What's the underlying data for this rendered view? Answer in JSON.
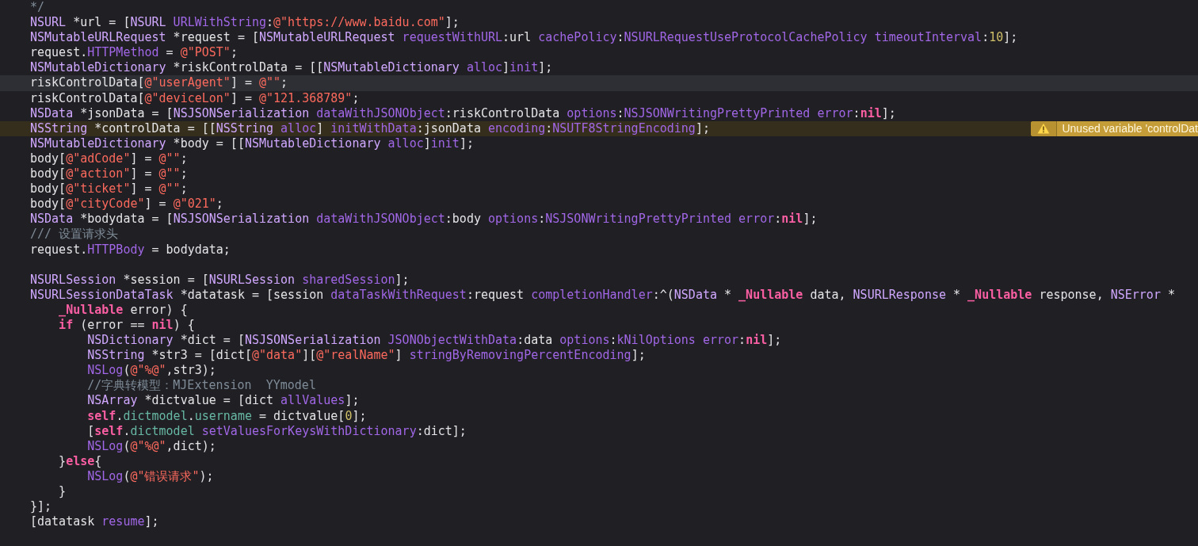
{
  "editor": {
    "lines": [
      {
        "current": false,
        "tokens": [
          {
            "kind": "comment",
            "text": "*/"
          }
        ]
      },
      {
        "current": false,
        "tokens": [
          {
            "kind": "type",
            "text": "NSURL"
          },
          {
            "kind": "plain",
            "text": " *url = ["
          },
          {
            "kind": "type",
            "text": "NSURL"
          },
          {
            "kind": "method",
            "text": " URLWithString"
          },
          {
            "kind": "plain",
            "text": ":"
          },
          {
            "kind": "string",
            "text": "@\"https://www.baidu.com\""
          },
          {
            "kind": "plain",
            "text": "];"
          }
        ]
      },
      {
        "current": false,
        "tokens": [
          {
            "kind": "type",
            "text": "NSMutableURLRequest"
          },
          {
            "kind": "plain",
            "text": " *request = ["
          },
          {
            "kind": "type",
            "text": "NSMutableURLRequest"
          },
          {
            "kind": "method",
            "text": " requestWithURL"
          },
          {
            "kind": "plain",
            "text": ":url "
          },
          {
            "kind": "method",
            "text": "cachePolicy"
          },
          {
            "kind": "plain",
            "text": ":"
          },
          {
            "kind": "method",
            "text": "NSURLRequestUseProtocolCachePolicy"
          },
          {
            "kind": "method",
            "text": " timeoutInterval"
          },
          {
            "kind": "plain",
            "text": ":"
          },
          {
            "kind": "number",
            "text": "10"
          },
          {
            "kind": "plain",
            "text": "];"
          }
        ]
      },
      {
        "current": false,
        "tokens": [
          {
            "kind": "plain",
            "text": "request."
          },
          {
            "kind": "method",
            "text": "HTTPMethod"
          },
          {
            "kind": "plain",
            "text": " = "
          },
          {
            "kind": "string",
            "text": "@\"POST\""
          },
          {
            "kind": "plain",
            "text": ";"
          }
        ]
      },
      {
        "current": false,
        "tokens": [
          {
            "kind": "type",
            "text": "NSMutableDictionary"
          },
          {
            "kind": "plain",
            "text": " *riskControlData = [["
          },
          {
            "kind": "type",
            "text": "NSMutableDictionary"
          },
          {
            "kind": "method",
            "text": " alloc"
          },
          {
            "kind": "plain",
            "text": "]"
          },
          {
            "kind": "method",
            "text": "init"
          },
          {
            "kind": "plain",
            "text": "];"
          }
        ]
      },
      {
        "current": true,
        "tokens": [
          {
            "kind": "plain",
            "text": "riskControlData["
          },
          {
            "kind": "string",
            "text": "@\"userAgent\""
          },
          {
            "kind": "plain",
            "text": "] = "
          },
          {
            "kind": "string",
            "text": "@\"\""
          },
          {
            "kind": "plain",
            "text": ";"
          }
        ]
      },
      {
        "current": false,
        "tokens": [
          {
            "kind": "plain",
            "text": "riskControlData["
          },
          {
            "kind": "string",
            "text": "@\"deviceLon\""
          },
          {
            "kind": "plain",
            "text": "] = "
          },
          {
            "kind": "string",
            "text": "@\"121.368789\""
          },
          {
            "kind": "plain",
            "text": ";"
          }
        ]
      },
      {
        "current": false,
        "tokens": [
          {
            "kind": "type",
            "text": "NSData"
          },
          {
            "kind": "plain",
            "text": " *jsonData = ["
          },
          {
            "kind": "type",
            "text": "NSJSONSerialization"
          },
          {
            "kind": "method",
            "text": " dataWithJSONObject"
          },
          {
            "kind": "plain",
            "text": ":riskControlData "
          },
          {
            "kind": "method",
            "text": "options"
          },
          {
            "kind": "plain",
            "text": ":"
          },
          {
            "kind": "method",
            "text": "NSJSONWritingPrettyPrinted"
          },
          {
            "kind": "method",
            "text": " error"
          },
          {
            "kind": "plain",
            "text": ":"
          },
          {
            "kind": "keyword",
            "text": "nil"
          },
          {
            "kind": "plain",
            "text": "];"
          }
        ]
      },
      {
        "current": false,
        "warning": "Unused variable 'controlDat",
        "tokens": [
          {
            "kind": "type",
            "text": "NSString"
          },
          {
            "kind": "plain",
            "text": " *controlData = [["
          },
          {
            "kind": "type",
            "text": "NSString"
          },
          {
            "kind": "method",
            "text": " alloc"
          },
          {
            "kind": "plain",
            "text": "] "
          },
          {
            "kind": "method",
            "text": "initWithData"
          },
          {
            "kind": "plain",
            "text": ":jsonData "
          },
          {
            "kind": "method",
            "text": "encoding"
          },
          {
            "kind": "plain",
            "text": ":"
          },
          {
            "kind": "method",
            "text": "NSUTF8StringEncoding"
          },
          {
            "kind": "plain",
            "text": "];"
          }
        ]
      },
      {
        "current": false,
        "tokens": [
          {
            "kind": "type",
            "text": "NSMutableDictionary"
          },
          {
            "kind": "plain",
            "text": " *body = [["
          },
          {
            "kind": "type",
            "text": "NSMutableDictionary"
          },
          {
            "kind": "method",
            "text": " alloc"
          },
          {
            "kind": "plain",
            "text": "]"
          },
          {
            "kind": "method",
            "text": "init"
          },
          {
            "kind": "plain",
            "text": "];"
          }
        ]
      },
      {
        "current": false,
        "tokens": [
          {
            "kind": "plain",
            "text": "body["
          },
          {
            "kind": "string",
            "text": "@\"adCode\""
          },
          {
            "kind": "plain",
            "text": "] = "
          },
          {
            "kind": "string",
            "text": "@\"\""
          },
          {
            "kind": "plain",
            "text": ";"
          }
        ]
      },
      {
        "current": false,
        "tokens": [
          {
            "kind": "plain",
            "text": "body["
          },
          {
            "kind": "string",
            "text": "@\"action\""
          },
          {
            "kind": "plain",
            "text": "] = "
          },
          {
            "kind": "string",
            "text": "@\"\""
          },
          {
            "kind": "plain",
            "text": ";"
          }
        ]
      },
      {
        "current": false,
        "tokens": [
          {
            "kind": "plain",
            "text": "body["
          },
          {
            "kind": "string",
            "text": "@\"ticket\""
          },
          {
            "kind": "plain",
            "text": "] = "
          },
          {
            "kind": "string",
            "text": "@\"\""
          },
          {
            "kind": "plain",
            "text": ";"
          }
        ]
      },
      {
        "current": false,
        "tokens": [
          {
            "kind": "plain",
            "text": "body["
          },
          {
            "kind": "string",
            "text": "@\"cityCode\""
          },
          {
            "kind": "plain",
            "text": "] = "
          },
          {
            "kind": "string",
            "text": "@\"021\""
          },
          {
            "kind": "plain",
            "text": ";"
          }
        ]
      },
      {
        "current": false,
        "tokens": [
          {
            "kind": "type",
            "text": "NSData"
          },
          {
            "kind": "plain",
            "text": " *bodydata = ["
          },
          {
            "kind": "type",
            "text": "NSJSONSerialization"
          },
          {
            "kind": "method",
            "text": " dataWithJSONObject"
          },
          {
            "kind": "plain",
            "text": ":body "
          },
          {
            "kind": "method",
            "text": "options"
          },
          {
            "kind": "plain",
            "text": ":"
          },
          {
            "kind": "method",
            "text": "NSJSONWritingPrettyPrinted"
          },
          {
            "kind": "method",
            "text": " error"
          },
          {
            "kind": "plain",
            "text": ":"
          },
          {
            "kind": "keyword",
            "text": "nil"
          },
          {
            "kind": "plain",
            "text": "];"
          }
        ]
      },
      {
        "current": false,
        "tokens": [
          {
            "kind": "comment",
            "text": "/// 设置请求头"
          }
        ]
      },
      {
        "current": false,
        "tokens": [
          {
            "kind": "plain",
            "text": "request."
          },
          {
            "kind": "method",
            "text": "HTTPBody"
          },
          {
            "kind": "plain",
            "text": " = bodydata;"
          }
        ]
      },
      {
        "current": false
      },
      {
        "current": false,
        "tokens": [
          {
            "kind": "type",
            "text": "NSURLSession"
          },
          {
            "kind": "plain",
            "text": " *session = ["
          },
          {
            "kind": "type",
            "text": "NSURLSession"
          },
          {
            "kind": "method",
            "text": " sharedSession"
          },
          {
            "kind": "plain",
            "text": "];"
          }
        ]
      },
      {
        "current": false,
        "tokens": [
          {
            "kind": "type",
            "text": "NSURLSessionDataTask"
          },
          {
            "kind": "plain",
            "text": " *datatask = [session "
          },
          {
            "kind": "method",
            "text": "dataTaskWithRequest"
          },
          {
            "kind": "plain",
            "text": ":request "
          },
          {
            "kind": "method",
            "text": "completionHandler"
          },
          {
            "kind": "plain",
            "text": ":^("
          },
          {
            "kind": "type",
            "text": "NSData"
          },
          {
            "kind": "plain",
            "text": " * "
          },
          {
            "kind": "keyword",
            "text": "_Nullable"
          },
          {
            "kind": "plain",
            "text": " data, "
          },
          {
            "kind": "type",
            "text": "NSURLResponse"
          },
          {
            "kind": "plain",
            "text": " * "
          },
          {
            "kind": "keyword",
            "text": "_Nullable"
          },
          {
            "kind": "plain",
            "text": " response, "
          },
          {
            "kind": "type",
            "text": "NSError"
          },
          {
            "kind": "plain",
            "text": " *"
          }
        ]
      },
      {
        "current": false,
        "tokens": [
          {
            "kind": "keyword",
            "text": "    _Nullable"
          },
          {
            "kind": "plain",
            "text": " error) {"
          }
        ]
      },
      {
        "current": false,
        "tokens": [
          {
            "kind": "keyword",
            "text": "    if"
          },
          {
            "kind": "plain",
            "text": " (error == "
          },
          {
            "kind": "keyword",
            "text": "nil"
          },
          {
            "kind": "plain",
            "text": ") {"
          }
        ]
      },
      {
        "current": false,
        "tokens": [
          {
            "kind": "type",
            "text": "        NSDictionary"
          },
          {
            "kind": "plain",
            "text": " *dict = ["
          },
          {
            "kind": "type",
            "text": "NSJSONSerialization"
          },
          {
            "kind": "method",
            "text": " JSONObjectWithData"
          },
          {
            "kind": "plain",
            "text": ":data "
          },
          {
            "kind": "method",
            "text": "options"
          },
          {
            "kind": "plain",
            "text": ":"
          },
          {
            "kind": "method",
            "text": "kNilOptions"
          },
          {
            "kind": "method",
            "text": " error"
          },
          {
            "kind": "plain",
            "text": ":"
          },
          {
            "kind": "keyword",
            "text": "nil"
          },
          {
            "kind": "plain",
            "text": "];"
          }
        ]
      },
      {
        "current": false,
        "tokens": [
          {
            "kind": "type",
            "text": "        NSString"
          },
          {
            "kind": "plain",
            "text": " *str3 = [dict["
          },
          {
            "kind": "string",
            "text": "@\"data\""
          },
          {
            "kind": "plain",
            "text": "]["
          },
          {
            "kind": "string",
            "text": "@\"realName\""
          },
          {
            "kind": "plain",
            "text": "] "
          },
          {
            "kind": "method",
            "text": "stringByRemovingPercentEncoding"
          },
          {
            "kind": "plain",
            "text": "];"
          }
        ]
      },
      {
        "current": false,
        "tokens": [
          {
            "kind": "method",
            "text": "        NSLog"
          },
          {
            "kind": "plain",
            "text": "("
          },
          {
            "kind": "string",
            "text": "@\"%@\""
          },
          {
            "kind": "plain",
            "text": ",str3);"
          }
        ]
      },
      {
        "current": false,
        "tokens": [
          {
            "kind": "comment",
            "text": "        //字典转模型：MJExtension  YYmodel"
          }
        ]
      },
      {
        "current": false,
        "tokens": [
          {
            "kind": "type",
            "text": "        NSArray"
          },
          {
            "kind": "plain",
            "text": " *dictvalue = [dict "
          },
          {
            "kind": "method",
            "text": "allValues"
          },
          {
            "kind": "plain",
            "text": "];"
          }
        ]
      },
      {
        "current": false,
        "tokens": [
          {
            "kind": "keyword",
            "text": "        self"
          },
          {
            "kind": "plain",
            "text": "."
          },
          {
            "kind": "member",
            "text": "dictmodel"
          },
          {
            "kind": "plain",
            "text": "."
          },
          {
            "kind": "member",
            "text": "username"
          },
          {
            "kind": "plain",
            "text": " = dictvalue["
          },
          {
            "kind": "number",
            "text": "0"
          },
          {
            "kind": "plain",
            "text": "];"
          }
        ]
      },
      {
        "current": false,
        "tokens": [
          {
            "kind": "plain",
            "text": "        ["
          },
          {
            "kind": "keyword",
            "text": "self"
          },
          {
            "kind": "plain",
            "text": "."
          },
          {
            "kind": "member",
            "text": "dictmodel"
          },
          {
            "kind": "method",
            "text": " setValuesForKeysWithDictionary"
          },
          {
            "kind": "plain",
            "text": ":dict];"
          }
        ]
      },
      {
        "current": false,
        "tokens": [
          {
            "kind": "method",
            "text": "        NSLog"
          },
          {
            "kind": "plain",
            "text": "("
          },
          {
            "kind": "string",
            "text": "@\"%@\""
          },
          {
            "kind": "plain",
            "text": ",dict);"
          }
        ]
      },
      {
        "current": false,
        "tokens": [
          {
            "kind": "plain",
            "text": "    }"
          },
          {
            "kind": "keyword",
            "text": "else"
          },
          {
            "kind": "plain",
            "text": "{"
          }
        ]
      },
      {
        "current": false,
        "tokens": [
          {
            "kind": "method",
            "text": "        NSLog"
          },
          {
            "kind": "plain",
            "text": "("
          },
          {
            "kind": "string",
            "text": "@\"错误请求\""
          },
          {
            "kind": "plain",
            "text": ");"
          }
        ]
      },
      {
        "current": false,
        "tokens": [
          {
            "kind": "plain",
            "text": "    }"
          }
        ]
      },
      {
        "current": false,
        "tokens": [
          {
            "kind": "plain",
            "text": "}];"
          }
        ]
      },
      {
        "current": false,
        "tokens": [
          {
            "kind": "plain",
            "text": "[datatask "
          },
          {
            "kind": "method",
            "text": "resume"
          },
          {
            "kind": "plain",
            "text": "];"
          }
        ]
      }
    ]
  }
}
